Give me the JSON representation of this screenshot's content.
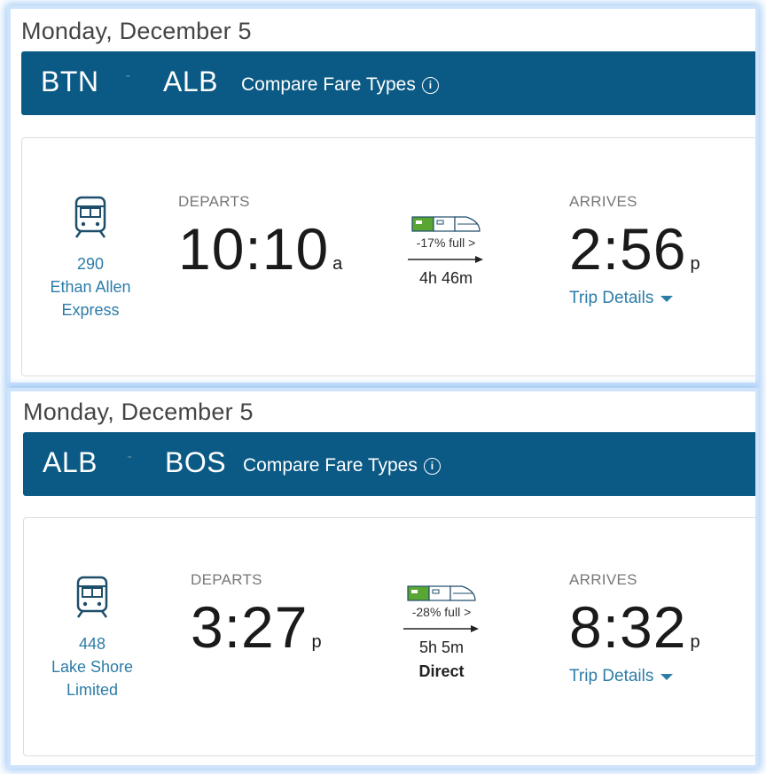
{
  "segments": [
    {
      "date": "Monday, December 5",
      "from": "BTN",
      "to": "ALB",
      "compare_label": "Compare Fare Types",
      "train_number": "290",
      "train_name_line1": "Ethan Allen",
      "train_name_line2": "Express",
      "departs_label": "DEPARTS",
      "depart_time": "10:10",
      "depart_ampm": "a",
      "capacity_text": "-17% full >",
      "duration": "4h 46m",
      "direct": "",
      "arrives_label": "ARRIVES",
      "arrive_time": "2:56",
      "arrive_ampm": "p",
      "trip_details_label": "Trip Details"
    },
    {
      "date": "Monday, December 5",
      "from": "ALB",
      "to": "BOS",
      "compare_label": "Compare Fare Types",
      "train_number": "448",
      "train_name_line1": "Lake Shore",
      "train_name_line2": "Limited",
      "departs_label": "DEPARTS",
      "depart_time": "3:27",
      "depart_ampm": "p",
      "capacity_text": "-28% full >",
      "duration": "5h 5m",
      "direct": "Direct",
      "arrives_label": "ARRIVES",
      "arrive_time": "8:32",
      "arrive_ampm": "p",
      "trip_details_label": "Trip Details"
    }
  ],
  "colors": {
    "route_bar": "#0b5a85",
    "link": "#2c7ca8",
    "capacity_green": "#5aa632"
  },
  "icons": {
    "route_arrow": "arrow-right-icon",
    "info": "info-icon",
    "train": "train-icon",
    "capacity": "train-capacity-icon",
    "caret": "caret-down-icon"
  }
}
